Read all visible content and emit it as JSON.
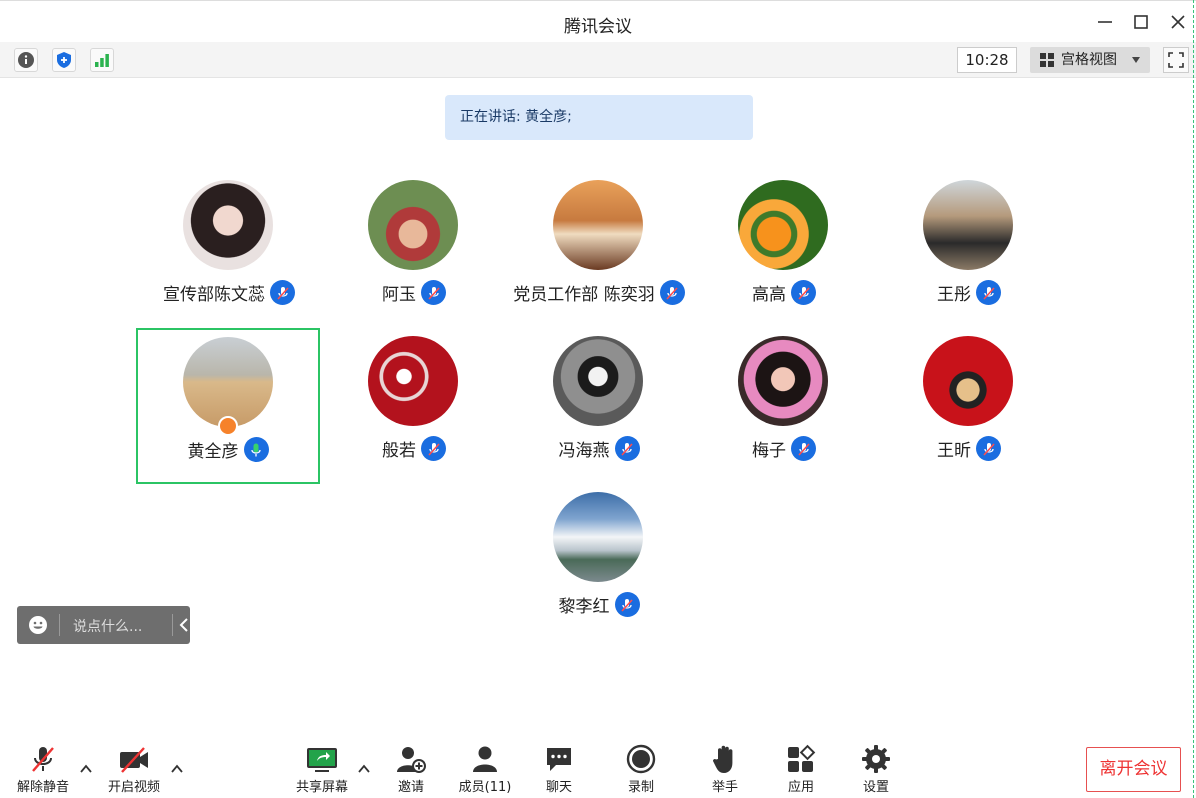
{
  "window": {
    "title": "腾讯会议"
  },
  "toolbar": {
    "time": "10:28",
    "view_label": "宫格视图"
  },
  "speaking": {
    "text": "正在讲话: 黄全彦;"
  },
  "participants": [
    {
      "name": "宣传部陈文蕊",
      "muted": true
    },
    {
      "name": "阿玉",
      "muted": true
    },
    {
      "name": "党员工作部 陈奕羽",
      "muted": true
    },
    {
      "name": "高高",
      "muted": true
    },
    {
      "name": "王彤",
      "muted": true
    },
    {
      "name": "黄全彦",
      "muted": false,
      "speaking": true,
      "host": true
    },
    {
      "name": "般若",
      "muted": true
    },
    {
      "name": "冯海燕",
      "muted": true
    },
    {
      "name": "梅子",
      "muted": true
    },
    {
      "name": "王昕",
      "muted": true
    },
    {
      "name": "黎李红",
      "muted": true
    }
  ],
  "chat": {
    "placeholder": "说点什么..."
  },
  "bottom": {
    "unmute": "解除静音",
    "video": "开启视频",
    "share": "共享屏幕",
    "invite": "邀请",
    "members": "成员(11)",
    "chat": "聊天",
    "record": "录制",
    "raise_hand": "举手",
    "apps": "应用",
    "settings": "设置",
    "leave": "离开会议"
  },
  "colors": {
    "active_border": "#2bc464",
    "mic_blue": "#1a6de0",
    "leave_red": "#e33333",
    "speaking_bg": "#d9e8fb"
  }
}
